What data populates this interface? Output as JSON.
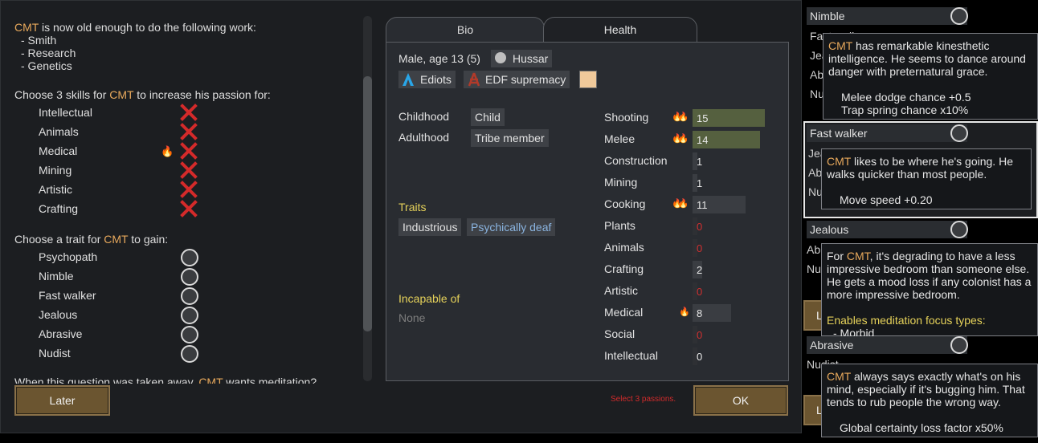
{
  "dialog": {
    "intro_name": "CMT",
    "intro_text": " is now old enough to do the following work:",
    "work": [
      "- Smith",
      "- Research",
      "- Genetics"
    ],
    "skills_prompt_pre": "Choose 3 skills for ",
    "skills_prompt_name": "CMT",
    "skills_prompt_post": " to increase his passion for:",
    "skills": [
      "Intellectual",
      "Animals",
      "Medical",
      "Mining",
      "Artistic",
      "Crafting"
    ],
    "trait_prompt_pre": "Choose a trait for ",
    "trait_prompt_name": "CMT",
    "trait_prompt_post": " to gain:",
    "traits": [
      "Psychopath",
      "Nimble",
      "Fast walker",
      "Jealous",
      "Abrasive",
      "Nudist"
    ],
    "cutoff_text_pre": "When this question was taken away, ",
    "cutoff_text_name": "CMT",
    "cutoff_text_post": " wants meditation?",
    "later_button": "Later",
    "ok_button": "OK",
    "warning": "Select 3 passions."
  },
  "bio": {
    "tabs": [
      "Bio",
      "Health"
    ],
    "summary": "Male, age 13 (5)",
    "xenotype": "Hussar",
    "faction": "Ediots",
    "ideology": "EDF supremacy",
    "favorite_color": "#f0c99a",
    "childhood_label": "Childhood",
    "childhood": "Child",
    "adulthood_label": "Adulthood",
    "adulthood": "Tribe member",
    "traits_label": "Traits",
    "traits": [
      "Industrious",
      "Psychically deaf"
    ],
    "incapable_label": "Incapable of",
    "incapable": "None",
    "skills": [
      {
        "name": "Shooting",
        "level": "15",
        "passion": 2
      },
      {
        "name": "Melee",
        "level": "14",
        "passion": 2
      },
      {
        "name": "Construction",
        "level": "1",
        "passion": 0
      },
      {
        "name": "Mining",
        "level": "1",
        "passion": 0
      },
      {
        "name": "Cooking",
        "level": "11",
        "passion": 2
      },
      {
        "name": "Plants",
        "level": "0",
        "passion": 0
      },
      {
        "name": "Animals",
        "level": "0",
        "passion": 0
      },
      {
        "name": "Crafting",
        "level": "2",
        "passion": 0
      },
      {
        "name": "Artistic",
        "level": "0",
        "passion": 0
      },
      {
        "name": "Medical",
        "level": "8",
        "passion": 1
      },
      {
        "name": "Social",
        "level": "0",
        "passion": 0
      },
      {
        "name": "Intellectual",
        "level": "0",
        "passion": 0
      }
    ]
  },
  "right": {
    "rows": {
      "nimble": "Nimble",
      "fast_walker": "Fast walker",
      "jealous": "Jealous",
      "abrasive": "Abrasive",
      "partial_fast": "Fast walker",
      "partial_jea": "Jea",
      "partial_abr": "Abr",
      "partial_nud": "Nud",
      "partial_nudist": "Nudist",
      "partial_l": "L"
    },
    "tip_nimble": {
      "name": "CMT",
      "text": " has remarkable kinesthetic intelligence. He seems to dance around danger with preternatural grace.",
      "effect1": "Melee dodge chance +0.5",
      "effect2": "Trap spring chance x10%"
    },
    "tip_fast": {
      "name": "CMT",
      "text": " likes to be where he's going. He walks quicker than most people.",
      "effect1": "Move speed +0.20"
    },
    "tip_jealous": {
      "pre": "For ",
      "name": "CMT",
      "text": ", it's degrading to have a less impressive bedroom than someone else. He gets a mood loss if any colonist has a more impressive bedroom.",
      "enables": "Enables meditation focus types:",
      "focus": "- Morbid"
    },
    "tip_abrasive": {
      "name": "CMT",
      "text": " always says exactly what's on his mind, especially if it's bugging him. That tends to rub people the wrong way.",
      "effect1": "Global certainty loss factor x50%"
    }
  }
}
